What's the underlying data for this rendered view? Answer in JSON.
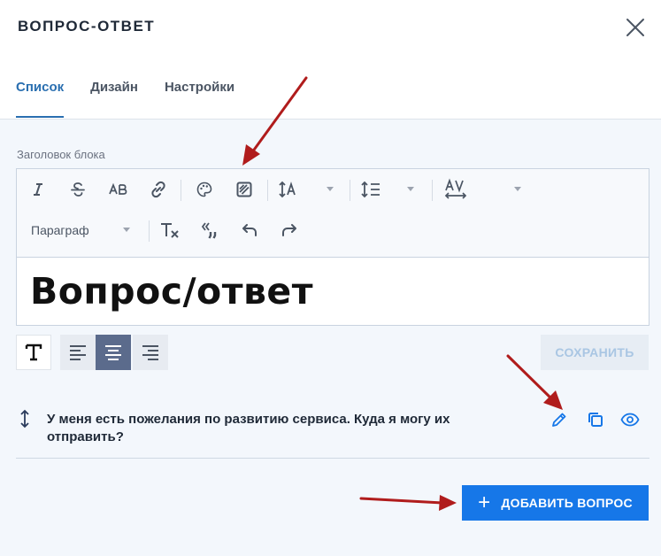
{
  "header": {
    "title": "ВОПРОС-ОТВЕТ",
    "tabs": [
      {
        "label": "Список",
        "active": true
      },
      {
        "label": "Дизайн",
        "active": false
      },
      {
        "label": "Настройки",
        "active": false
      }
    ]
  },
  "block_title": {
    "label": "Заголовок блока",
    "paragraph_select": "Параграф",
    "toolbar_icons": [
      "italic-icon",
      "strikethrough-icon",
      "uppercase-icon",
      "link-icon",
      "palette-icon",
      "highlight-icon",
      "font-size-icon",
      "line-height-icon",
      "letter-spacing-icon",
      "clear-format-icon",
      "quotes-icon",
      "undo-icon",
      "redo-icon"
    ],
    "value": "Вопрос/ответ"
  },
  "actions": {
    "save_label": "СОХРАНИТЬ",
    "add_label": "ДОБАВИТЬ ВОПРОС"
  },
  "questions": [
    {
      "text": "У меня есть пожелания по развитию сервиса. Куда я могу их отправить?"
    }
  ],
  "colors": {
    "accent": "#1677e8",
    "tab_active": "#2a6fb0",
    "annotation_arrow": "#b01c1c",
    "align_active": "#5b6b8c"
  }
}
